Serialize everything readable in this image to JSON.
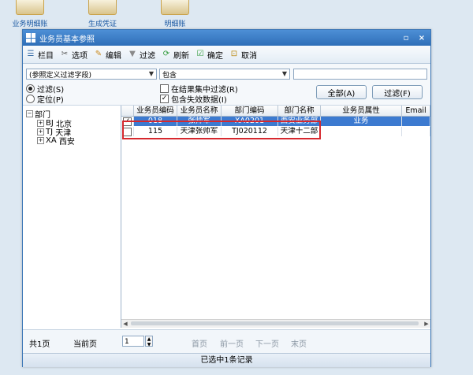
{
  "desktop": {
    "icons": [
      {
        "label": "业务明细账"
      },
      {
        "label": "生成凭证"
      },
      {
        "label": "明细账"
      }
    ]
  },
  "window": {
    "title": "业务员基本参照",
    "controls": {
      "restore": "▫",
      "close": "×"
    }
  },
  "toolbar": {
    "items": [
      {
        "label": "栏目",
        "icon": "columns-icon"
      },
      {
        "label": "选项",
        "icon": "scissors-icon"
      },
      {
        "label": "编辑",
        "icon": "pencil-icon"
      },
      {
        "label": "过滤",
        "icon": "funnel-icon"
      },
      {
        "label": "刷新",
        "icon": "refresh-icon"
      },
      {
        "label": "确定",
        "icon": "check-icon"
      },
      {
        "label": "取消",
        "icon": "cancel-icon"
      }
    ]
  },
  "filter": {
    "field_select": "(参照定义过滤字段)",
    "condition_select": "包含",
    "value": "",
    "mode_filter": "过滤(S)",
    "mode_locate": "定位(P)",
    "in_result": "在结果集中过滤(R)",
    "include_invalid": "包含失效数据(I)",
    "btn_all": "全部(A)",
    "btn_filter": "过滤(F)"
  },
  "tree": {
    "root": "部门",
    "children": [
      {
        "code": "BJ",
        "name": "北京"
      },
      {
        "code": "TJ",
        "name": "天津"
      },
      {
        "code": "XA",
        "name": "西安"
      }
    ]
  },
  "grid": {
    "columns": [
      "业务员编码",
      "业务员名称",
      "部门编码",
      "部门名称",
      "业务员属性",
      "Email"
    ],
    "rows": [
      {
        "checked": true,
        "selected": true,
        "cells": [
          "018",
          "张帅军",
          "XA0201",
          "西安业务部",
          "业务",
          ""
        ]
      },
      {
        "checked": false,
        "selected": false,
        "cells": [
          "115",
          "天津张帅军",
          "TJ020112",
          "天津十二部",
          "",
          ""
        ]
      }
    ]
  },
  "pager": {
    "total_pages": "共1页",
    "current_label": "当前页",
    "current_value": "1",
    "first": "首页",
    "prev": "前一页",
    "next": "下一页",
    "last": "末页"
  },
  "status": "已选中1条记录",
  "colors": {
    "title_bar": "#2f6fb8",
    "selection": "#3c7ad0",
    "highlight_box": "#d6282e"
  }
}
